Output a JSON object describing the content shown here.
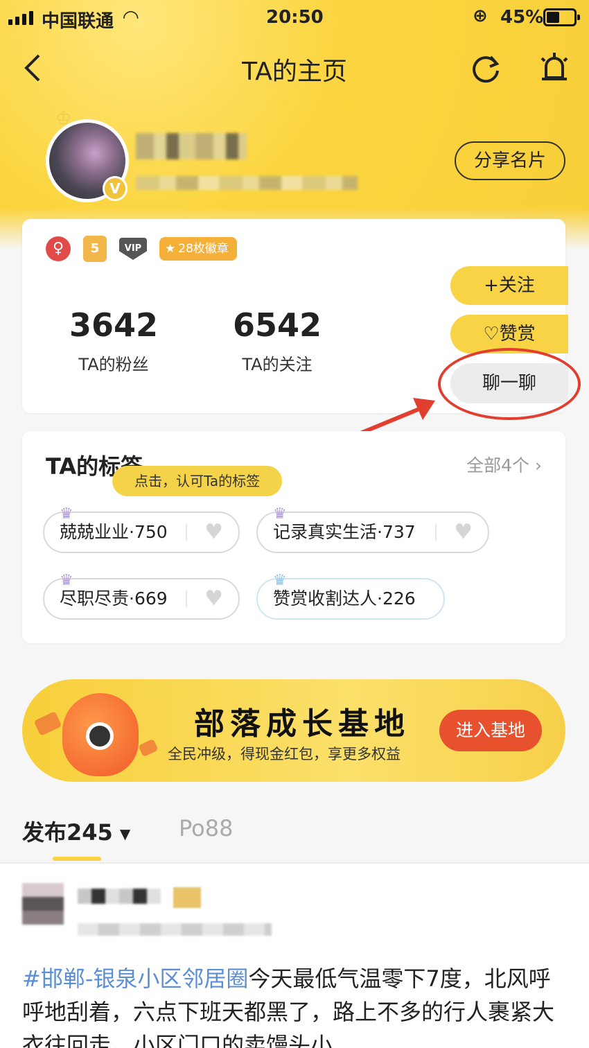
{
  "status": {
    "carrier": "中国联通",
    "time": "20:50",
    "battery_pct": "45%"
  },
  "nav": {
    "back": "<",
    "title": "TA的主页"
  },
  "profile": {
    "share_label": "分享名片",
    "avatar_badge": "V"
  },
  "badges": {
    "gender": "♀",
    "level": "5",
    "vip": "VIP",
    "medals": "28枚徽章"
  },
  "stats": [
    {
      "value": "3642",
      "label": "TA的粉丝"
    },
    {
      "value": "6542",
      "label": "TA的关注"
    }
  ],
  "actions": {
    "follow": "+关注",
    "reward": "赞赏",
    "chat": "聊一聊"
  },
  "tags": {
    "title": "TA的标签",
    "all": "全部4个 ›",
    "tip": "点击，认可Ta的标签",
    "items": [
      {
        "label": "兢兢业业·750"
      },
      {
        "label": "记录真实生活·737"
      },
      {
        "label": "尽职尽责·669"
      },
      {
        "label": "赞赏收割达人·226"
      }
    ]
  },
  "banner": {
    "title": "部落成长基地",
    "subtitle": "全民冲级，得现金红包，享更多权益",
    "button": "进入基地"
  },
  "tabs": {
    "posts": "发布245",
    "po": "Po88"
  },
  "post": {
    "hashtag": "#邯郸-银泉小区邻居圈",
    "text": "今天最低气温零下7度，北风呼呼地刮着，六点下班天都黑了，路上不多的行人裹紧大衣往回走，小区门口的卖馒头小"
  },
  "colors": {
    "accent": "#f7d345",
    "highlight": "#e23e2f",
    "link": "#5a8fd6"
  }
}
